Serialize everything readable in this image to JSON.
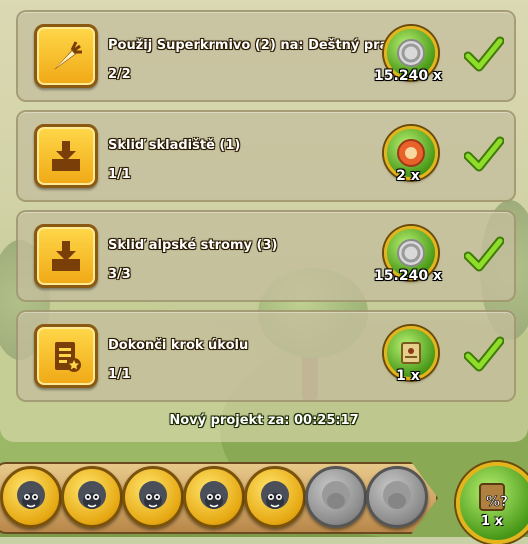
{
  "tasks": [
    {
      "icon": "carrot-icon",
      "title": "Použij Superkrmivo (2) na: Deštný prales",
      "progress": "2/2",
      "reward_icon": "silver-coin-icon",
      "reward_count": "15.240 x",
      "completed": true
    },
    {
      "icon": "storage-box-icon",
      "title": "Skliď skladiště (1)",
      "progress": "1/1",
      "reward_icon": "food-bowl-icon",
      "reward_count": "2 x",
      "completed": true
    },
    {
      "icon": "storage-box-icon",
      "title": "Skliď alpské stromy (3)",
      "progress": "3/3",
      "reward_icon": "silver-coin-icon",
      "reward_count": "15.240 x",
      "completed": true
    },
    {
      "icon": "clipboard-star-icon",
      "title": "Dokonči krok úkolu",
      "progress": "1/1",
      "reward_icon": "scroll-map-icon",
      "reward_count": "1 x",
      "completed": true
    }
  ],
  "timer": "Nový projekt za: 00:25:17",
  "slots": [
    {
      "state": "filled",
      "icon": "sheep-head-icon"
    },
    {
      "state": "filled",
      "icon": "sheep-head-icon"
    },
    {
      "state": "filled",
      "icon": "sheep-head-icon"
    },
    {
      "state": "filled",
      "icon": "sheep-head-icon"
    },
    {
      "state": "filled",
      "icon": "sheep-head-icon"
    },
    {
      "state": "empty",
      "icon": "sheep-silhouette-icon"
    },
    {
      "state": "empty",
      "icon": "sheep-silhouette-icon"
    }
  ],
  "final_reward": {
    "icon": "mystery-box-icon",
    "count": "1 x"
  },
  "colors": {
    "accent_gold": "#f0a815",
    "check_green": "#6fbf1a",
    "medal_green": "#4a9a1a"
  }
}
